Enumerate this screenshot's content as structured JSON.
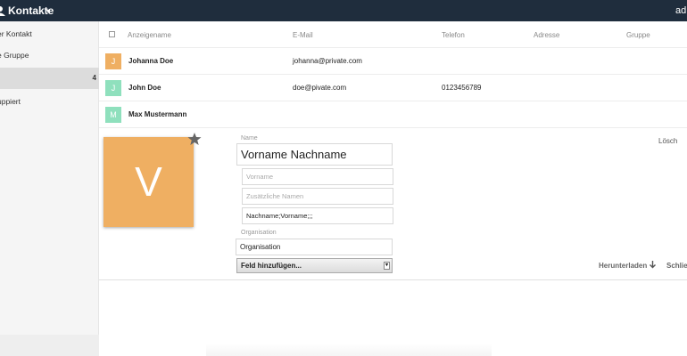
{
  "topbar": {
    "app_title": "Kontakte",
    "caret": "▾",
    "user_label": "adm"
  },
  "sidebar": {
    "items": [
      {
        "label": "er Kontakt"
      },
      {
        "label": "e Gruppe"
      },
      {
        "label": "",
        "count": "4"
      },
      {
        "label": "uppiert"
      }
    ]
  },
  "list": {
    "columns": [
      "Anzeigename",
      "E-Mail",
      "Telefon",
      "Adresse",
      "Gruppe"
    ],
    "rows": [
      {
        "initial": "J",
        "name": "Johanna Doe",
        "email": "johanna@private.com",
        "phone": "",
        "color": "#efaf62"
      },
      {
        "initial": "J",
        "name": "John Doe",
        "email": "doe@pivate.com",
        "phone": "0123456789",
        "color": "#8fe0bd"
      },
      {
        "initial": "M",
        "name": "Max Mustermann",
        "email": "",
        "phone": "",
        "color": "#8fe0bd"
      }
    ]
  },
  "detail": {
    "avatar_initial": "V",
    "avatar_color": "#efaf62",
    "name_label": "Name",
    "name_value": "Vorname Nachname",
    "vorname_placeholder": "Vorname",
    "zusatz_placeholder": "Zusätzliche Namen",
    "nachname_value": "Nachname;Vorname;;;",
    "org_label": "Organisation",
    "org_value": "Organisation",
    "add_field_label": "Feld hinzufügen...",
    "delete_label": "Lösch",
    "download_label": "Herunterladen",
    "close_label": "Schlie"
  },
  "icons": [
    "app-logo-icon",
    "star-icon",
    "download-icon",
    "select-caret-icon"
  ]
}
